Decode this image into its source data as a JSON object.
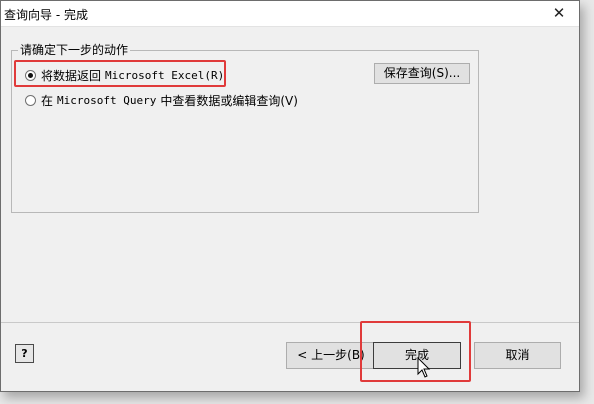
{
  "dialog": {
    "title": "查询向导 - 完成"
  },
  "group": {
    "label": "请确定下一步的动作"
  },
  "options": {
    "return_to_excel": {
      "prefix": "将数据返回",
      "suffix": "Microsoft Excel(R)",
      "checked": true
    },
    "view_in_query": {
      "prefix": "在",
      "app": "Microsoft Query",
      "suffix": "中查看数据或编辑查询(V)",
      "checked": false
    }
  },
  "buttons": {
    "save_query": "保存查询(S)...",
    "back": "< 上一步(B)",
    "finish": "完成",
    "cancel": "取消",
    "help": "?"
  },
  "colors": {
    "highlight": "#e03a3a",
    "window_bg": "#f0f0f0"
  }
}
